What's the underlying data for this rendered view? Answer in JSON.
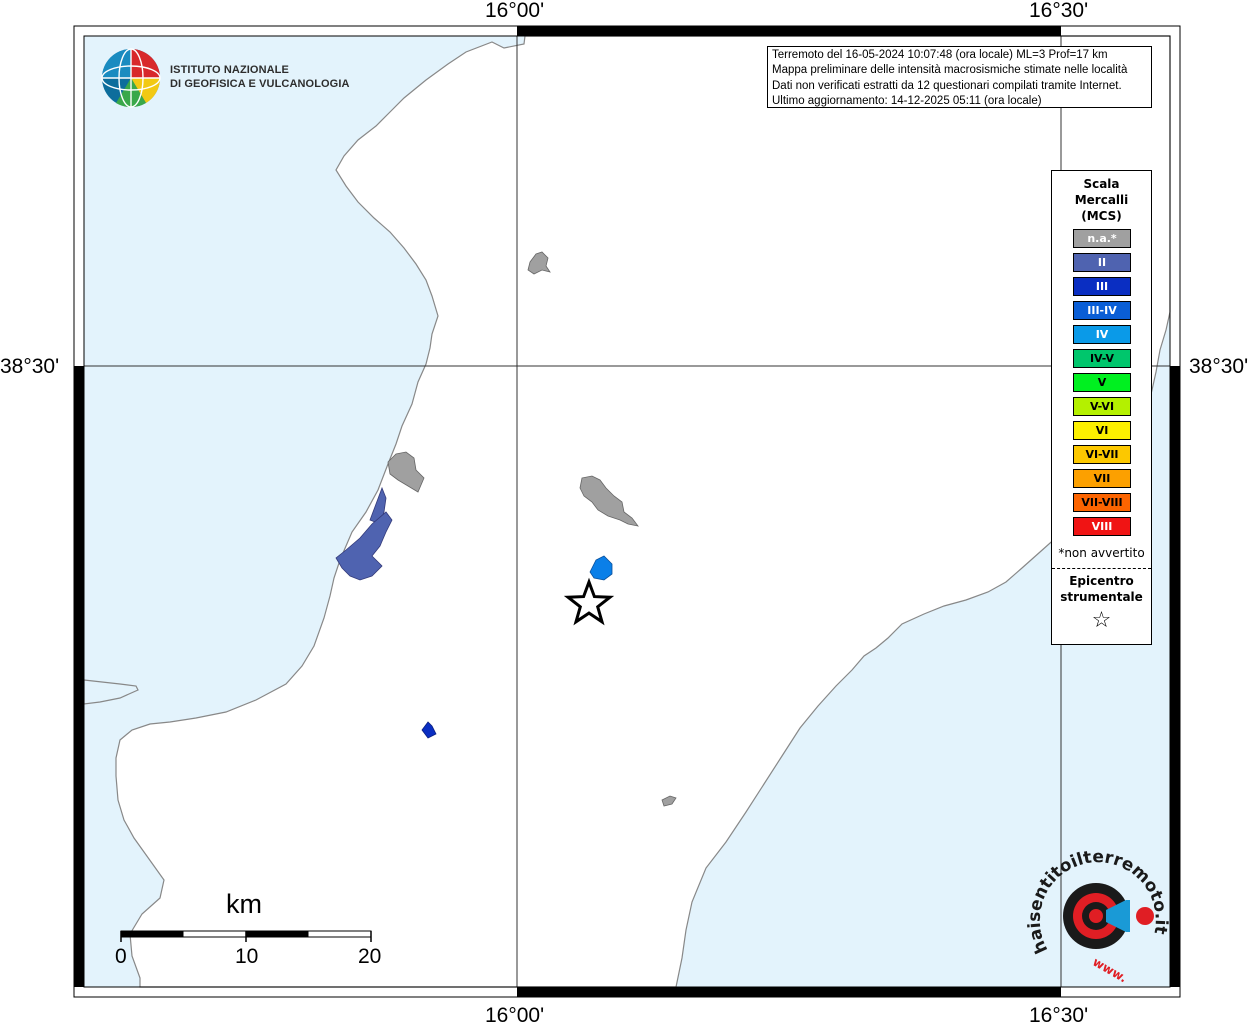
{
  "map": {
    "colors": {
      "sea": "#e3f3fc",
      "land": "#ffffff",
      "coastline": "#888888",
      "not_felt": "#a0a0a0",
      "intensity_II": "#4f63b0",
      "intensity_III": "#0a2ec2",
      "intensity_IV": "#0a7fe8"
    },
    "tick_labels": {
      "top_left": "16°00'",
      "top_right": "16°30'",
      "bottom_left": "16°00'",
      "bottom_right": "16°30'",
      "left": "38°30'",
      "right": "38°30'"
    }
  },
  "info_box": {
    "line1": "Terremoto del 16-05-2024 10:07:48 (ora locale) ML=3 Prof=17 km",
    "line2": "Mappa preliminare delle intensità macrosismiche stimate nelle località",
    "line3": "Dati non verificati estratti da 12 questionari compilati tramite Internet.",
    "line4": "Ultimo aggiornamento: 14-12-2025 05:11 (ora locale)"
  },
  "logo": {
    "line1": "ISTITUTO NAZIONALE",
    "line2": "DI GEOFISICA E VULCANOLOGIA"
  },
  "legend": {
    "title_line1": "Scala",
    "title_line2": "Mercalli",
    "title_line3": "(MCS)",
    "items": [
      {
        "label": "n.a.*",
        "color": "#a0a0a0",
        "text_color": "#ffffff"
      },
      {
        "label": "II",
        "color": "#4f63b0",
        "text_color": "#ffffff"
      },
      {
        "label": "III",
        "color": "#0a2ec2",
        "text_color": "#ffffff"
      },
      {
        "label": "III-IV",
        "color": "#0a5ed6",
        "text_color": "#ffffff"
      },
      {
        "label": "IV",
        "color": "#0a9ae8",
        "text_color": "#ffffff"
      },
      {
        "label": "IV-V",
        "color": "#00c66c",
        "text_color": "#000000"
      },
      {
        "label": "V",
        "color": "#00f020",
        "text_color": "#000000"
      },
      {
        "label": "V-VI",
        "color": "#b4f000",
        "text_color": "#000000"
      },
      {
        "label": "VI",
        "color": "#fcf000",
        "text_color": "#000000"
      },
      {
        "label": "VI-VII",
        "color": "#fcc800",
        "text_color": "#000000"
      },
      {
        "label": "VII",
        "color": "#fca000",
        "text_color": "#000000"
      },
      {
        "label": "VII-VIII",
        "color": "#fc6400",
        "text_color": "#000000"
      },
      {
        "label": "VIII",
        "color": "#f01414",
        "text_color": "#ffffff"
      }
    ],
    "note": "*non avvertito",
    "epicenter_line1": "Epicentro",
    "epicenter_line2": "strumentale",
    "epicenter_symbol": "☆"
  },
  "scale_bar": {
    "title": "km",
    "labels": [
      "0",
      "10",
      "20"
    ]
  },
  "watermark": {
    "text": "haisentitoilterremoto.it",
    "prefix": "www."
  }
}
